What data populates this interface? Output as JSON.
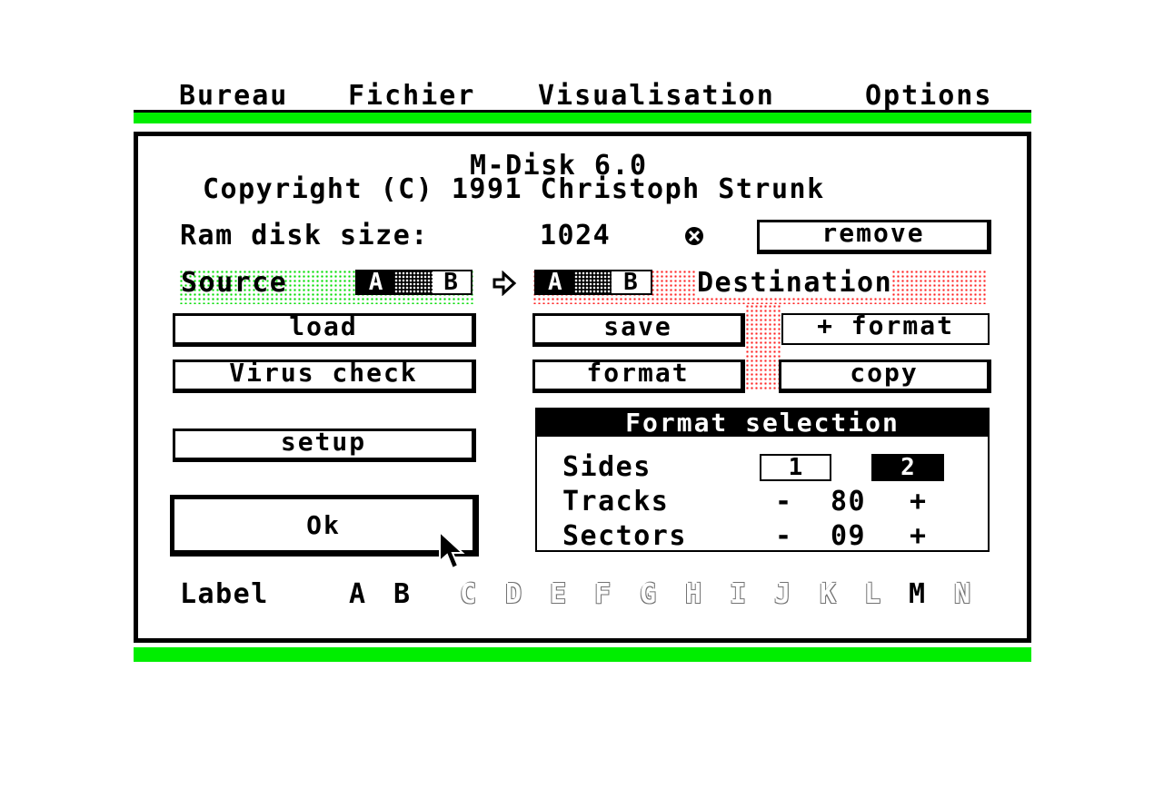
{
  "menu": {
    "bureau": "Bureau",
    "fichier": "Fichier",
    "visualisation": "Visualisation",
    "options": "Options"
  },
  "dialog": {
    "title": "M-Disk 6.0",
    "copyright": "Copyright (C) 1991 Christoph Strunk",
    "ram_label": "Ram disk size:",
    "ram_value": "1024",
    "remove_label": "remove",
    "source_label": "Source",
    "destination_label": "Destination",
    "source_drives": {
      "a": "A",
      "b": "B"
    },
    "dest_drives": {
      "a": "A",
      "b": "B"
    },
    "load_label": "load",
    "save_label": "save",
    "plus_format_label": "+ format",
    "virus_label": "Virus check",
    "format_label": "format",
    "copy_label": "copy",
    "setup_label": "setup",
    "ok_label": "Ok",
    "format_selection": {
      "title": "Format selection",
      "sides_label": "Sides",
      "side_options": [
        "1",
        "2"
      ],
      "selected_side": "2",
      "tracks_label": "Tracks",
      "tracks_value": "80",
      "sectors_label": "Sectors",
      "sectors_value": "09",
      "minus": "-",
      "plus": "+"
    },
    "label_row": {
      "label": "Label",
      "letters": [
        "A",
        "B",
        "C",
        "D",
        "E",
        "F",
        "G",
        "H",
        "I",
        "J",
        "K",
        "L",
        "M",
        "N"
      ],
      "enabled": [
        "A",
        "B",
        "M"
      ]
    }
  },
  "colors": {
    "menu_bar_accent": "#00ee00",
    "source_area": "#00dd00",
    "destination_area": "#ff2020"
  },
  "icons": [
    "radio-icon",
    "arrow-right-icon",
    "mouse-pointer-icon"
  ]
}
